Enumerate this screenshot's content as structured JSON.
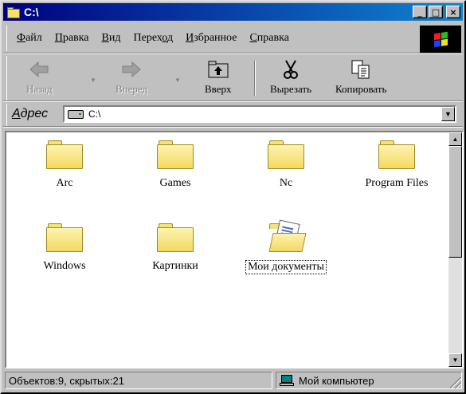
{
  "window": {
    "title": "C:\\"
  },
  "title_buttons": {
    "minimize": "_",
    "maximize": "□",
    "close": "×"
  },
  "menu": [
    {
      "label": "Файл",
      "hotkey_index": 0
    },
    {
      "label": "Правка",
      "hotkey_index": 0
    },
    {
      "label": "Вид",
      "hotkey_index": 0
    },
    {
      "label": "Переход",
      "hotkey_index": 5
    },
    {
      "label": "Избранное",
      "hotkey_index": 0
    },
    {
      "label": "Справка",
      "hotkey_index": 0
    }
  ],
  "toolbar": {
    "back": {
      "label": "Назад",
      "enabled": false,
      "icon": "arrow-left-icon"
    },
    "forward": {
      "label": "Вперед",
      "enabled": false,
      "icon": "arrow-right-icon"
    },
    "up": {
      "label": "Вверх",
      "enabled": true,
      "icon": "folder-up-icon"
    },
    "cut": {
      "label": "Вырезать",
      "enabled": true,
      "icon": "scissors-icon"
    },
    "copy": {
      "label": "Копировать",
      "enabled": true,
      "icon": "copy-icon"
    }
  },
  "address": {
    "label": "Адрес",
    "value": "C:\\",
    "icon": "drive-icon"
  },
  "items": [
    {
      "label": "Arc",
      "icon": "folder-icon",
      "selected": false
    },
    {
      "label": "Games",
      "icon": "folder-icon",
      "selected": false
    },
    {
      "label": "Nc",
      "icon": "folder-icon",
      "selected": false
    },
    {
      "label": "Program Files",
      "icon": "folder-icon",
      "selected": false
    },
    {
      "label": "Windows",
      "icon": "folder-icon",
      "selected": false
    },
    {
      "label": "Картинки",
      "icon": "folder-icon",
      "selected": false
    },
    {
      "label": "Мои документы",
      "icon": "my-documents-icon",
      "selected": true
    }
  ],
  "status": {
    "objects": "Объектов:9, скрытых:21",
    "location": "Мой компьютер",
    "location_icon": "computer-icon"
  },
  "colors": {
    "title_start": "#000080",
    "title_end": "#1084d0",
    "folder": "#f3d960",
    "face": "#c0c0c0"
  }
}
